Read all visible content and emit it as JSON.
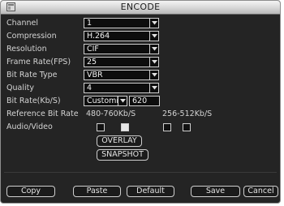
{
  "window": {
    "title": "ENCODE"
  },
  "fields": {
    "channel": {
      "label": "Channel",
      "value": "1"
    },
    "compression": {
      "label": "Compression",
      "value": "H.264"
    },
    "resolution": {
      "label": "Resolution",
      "value": "CIF"
    },
    "frame_rate": {
      "label": "Frame Rate(FPS)",
      "value": "25"
    },
    "bit_rate_type": {
      "label": "Bit Rate Type",
      "value": "VBR"
    },
    "quality": {
      "label": "Quality",
      "value": "4"
    },
    "bit_rate": {
      "label": "Bit Rate(Kb/S)",
      "select_value": "Customi",
      "input_value": "620"
    }
  },
  "reference": {
    "label": "Reference Bit Rate",
    "main": "480-760Kb/S",
    "extra": "256-512Kb/S"
  },
  "audio_video": {
    "label": "Audio/Video",
    "main_checked": [
      false,
      true
    ],
    "extra_checked": [
      false,
      false
    ]
  },
  "buttons": {
    "overlay": "OVERLAY",
    "snapshot": "SNAPSHOT",
    "copy": "Copy",
    "paste": "Paste",
    "default": "Default",
    "save": "Save",
    "cancel": "Cancel"
  },
  "colors": {
    "background": "#242424",
    "field_bg": "#0d0d0d",
    "border": "#cfcfcf",
    "text": "#d4d4d4"
  },
  "icons": {
    "app": "app-window-icon",
    "dropdown": "chevron-down-icon"
  }
}
